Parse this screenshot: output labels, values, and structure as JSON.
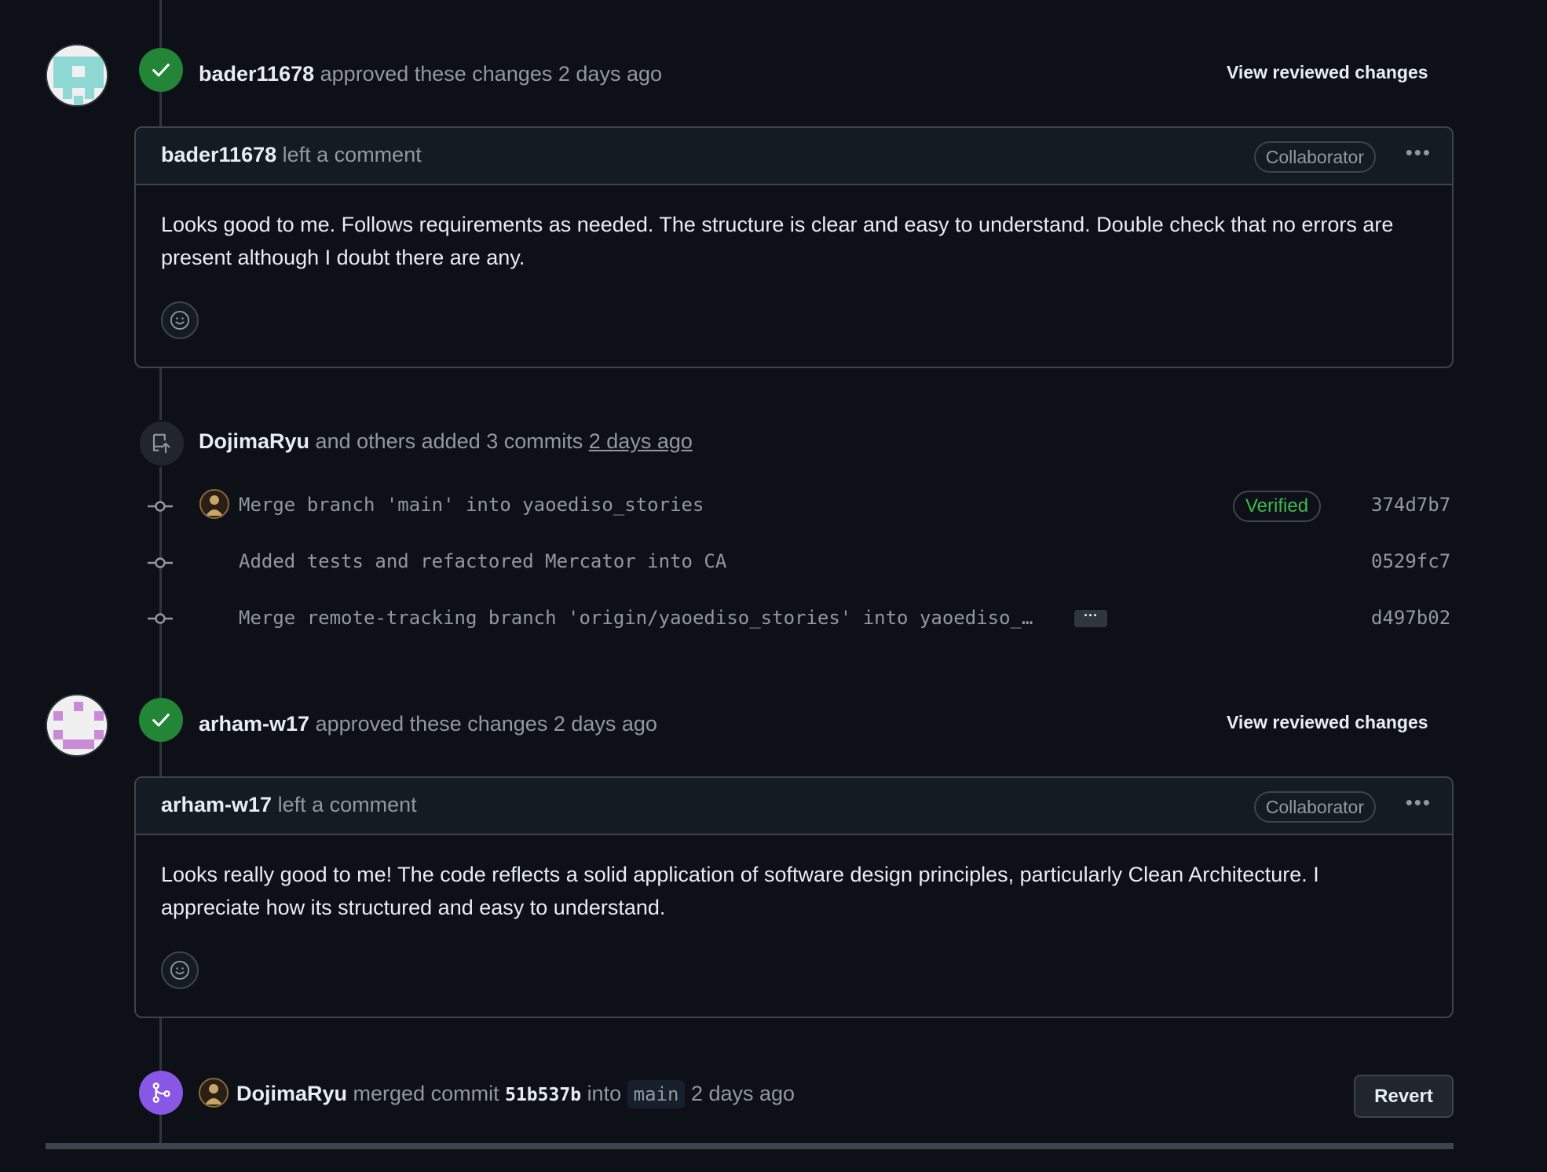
{
  "review1": {
    "user": "bader11678",
    "action": "approved these changes",
    "time": "2 days ago",
    "view_link": "View reviewed changes",
    "comment_user": "bader11678",
    "comment_action": "left a comment",
    "role": "Collaborator",
    "body": "Looks good to me. Follows requirements as needed. The structure is clear and easy to understand. Double check that no errors are present although I doubt there are any."
  },
  "commits_event": {
    "user": "DojimaRyu",
    "action": "and others added 3 commits",
    "time": "2 days ago",
    "commits": [
      {
        "message": "Merge branch 'main' into yaoediso_stories",
        "sha": "374d7b7",
        "verified": "Verified"
      },
      {
        "message": "Added tests and refactored Mercator into CA",
        "sha": "0529fc7"
      },
      {
        "message": "Merge remote-tracking branch 'origin/yaoediso_stories' into yaoediso_…",
        "sha": "d497b02",
        "expand": "···"
      }
    ]
  },
  "review2": {
    "user": "arham-w17",
    "action": "approved these changes",
    "time": "2 days ago",
    "view_link": "View reviewed changes",
    "comment_user": "arham-w17",
    "comment_action": "left a comment",
    "role": "Collaborator",
    "body": "Looks really good to me! The code reflects a solid application of software design principles, particularly Clean Architecture. I appreciate how its structured and easy to understand."
  },
  "merge_event": {
    "user": "DojimaRyu",
    "action": "merged commit",
    "commit": "51b537b",
    "into": "into",
    "branch": "main",
    "time": "2 days ago",
    "revert_label": "Revert"
  },
  "colors": {
    "approve_green": "#238636",
    "merge_purple": "#8957e5",
    "verified_green": "#3fb950",
    "background": "#0d1117"
  }
}
